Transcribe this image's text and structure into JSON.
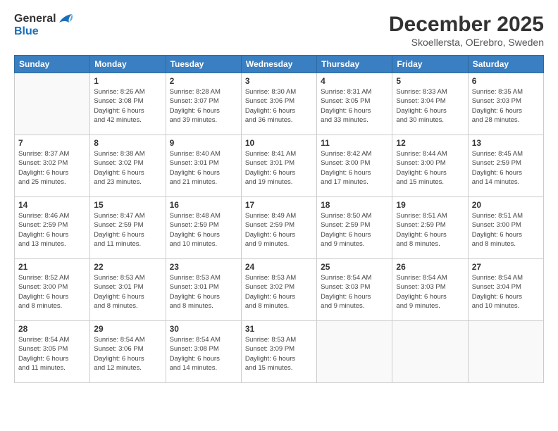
{
  "header": {
    "logo_general": "General",
    "logo_blue": "Blue",
    "main_title": "December 2025",
    "subtitle": "Skoellersta, OErebro, Sweden"
  },
  "calendar": {
    "days_of_week": [
      "Sunday",
      "Monday",
      "Tuesday",
      "Wednesday",
      "Thursday",
      "Friday",
      "Saturday"
    ],
    "weeks": [
      [
        {
          "day": "",
          "sunrise": "",
          "sunset": "",
          "daylight": ""
        },
        {
          "day": "1",
          "sunrise": "Sunrise: 8:26 AM",
          "sunset": "Sunset: 3:08 PM",
          "daylight": "Daylight: 6 hours and 42 minutes."
        },
        {
          "day": "2",
          "sunrise": "Sunrise: 8:28 AM",
          "sunset": "Sunset: 3:07 PM",
          "daylight": "Daylight: 6 hours and 39 minutes."
        },
        {
          "day": "3",
          "sunrise": "Sunrise: 8:30 AM",
          "sunset": "Sunset: 3:06 PM",
          "daylight": "Daylight: 6 hours and 36 minutes."
        },
        {
          "day": "4",
          "sunrise": "Sunrise: 8:31 AM",
          "sunset": "Sunset: 3:05 PM",
          "daylight": "Daylight: 6 hours and 33 minutes."
        },
        {
          "day": "5",
          "sunrise": "Sunrise: 8:33 AM",
          "sunset": "Sunset: 3:04 PM",
          "daylight": "Daylight: 6 hours and 30 minutes."
        },
        {
          "day": "6",
          "sunrise": "Sunrise: 8:35 AM",
          "sunset": "Sunset: 3:03 PM",
          "daylight": "Daylight: 6 hours and 28 minutes."
        }
      ],
      [
        {
          "day": "7",
          "sunrise": "Sunrise: 8:37 AM",
          "sunset": "Sunset: 3:02 PM",
          "daylight": "Daylight: 6 hours and 25 minutes."
        },
        {
          "day": "8",
          "sunrise": "Sunrise: 8:38 AM",
          "sunset": "Sunset: 3:02 PM",
          "daylight": "Daylight: 6 hours and 23 minutes."
        },
        {
          "day": "9",
          "sunrise": "Sunrise: 8:40 AM",
          "sunset": "Sunset: 3:01 PM",
          "daylight": "Daylight: 6 hours and 21 minutes."
        },
        {
          "day": "10",
          "sunrise": "Sunrise: 8:41 AM",
          "sunset": "Sunset: 3:01 PM",
          "daylight": "Daylight: 6 hours and 19 minutes."
        },
        {
          "day": "11",
          "sunrise": "Sunrise: 8:42 AM",
          "sunset": "Sunset: 3:00 PM",
          "daylight": "Daylight: 6 hours and 17 minutes."
        },
        {
          "day": "12",
          "sunrise": "Sunrise: 8:44 AM",
          "sunset": "Sunset: 3:00 PM",
          "daylight": "Daylight: 6 hours and 15 minutes."
        },
        {
          "day": "13",
          "sunrise": "Sunrise: 8:45 AM",
          "sunset": "Sunset: 2:59 PM",
          "daylight": "Daylight: 6 hours and 14 minutes."
        }
      ],
      [
        {
          "day": "14",
          "sunrise": "Sunrise: 8:46 AM",
          "sunset": "Sunset: 2:59 PM",
          "daylight": "Daylight: 6 hours and 13 minutes."
        },
        {
          "day": "15",
          "sunrise": "Sunrise: 8:47 AM",
          "sunset": "Sunset: 2:59 PM",
          "daylight": "Daylight: 6 hours and 11 minutes."
        },
        {
          "day": "16",
          "sunrise": "Sunrise: 8:48 AM",
          "sunset": "Sunset: 2:59 PM",
          "daylight": "Daylight: 6 hours and 10 minutes."
        },
        {
          "day": "17",
          "sunrise": "Sunrise: 8:49 AM",
          "sunset": "Sunset: 2:59 PM",
          "daylight": "Daylight: 6 hours and 9 minutes."
        },
        {
          "day": "18",
          "sunrise": "Sunrise: 8:50 AM",
          "sunset": "Sunset: 2:59 PM",
          "daylight": "Daylight: 6 hours and 9 minutes."
        },
        {
          "day": "19",
          "sunrise": "Sunrise: 8:51 AM",
          "sunset": "Sunset: 2:59 PM",
          "daylight": "Daylight: 6 hours and 8 minutes."
        },
        {
          "day": "20",
          "sunrise": "Sunrise: 8:51 AM",
          "sunset": "Sunset: 3:00 PM",
          "daylight": "Daylight: 6 hours and 8 minutes."
        }
      ],
      [
        {
          "day": "21",
          "sunrise": "Sunrise: 8:52 AM",
          "sunset": "Sunset: 3:00 PM",
          "daylight": "Daylight: 6 hours and 8 minutes."
        },
        {
          "day": "22",
          "sunrise": "Sunrise: 8:53 AM",
          "sunset": "Sunset: 3:01 PM",
          "daylight": "Daylight: 6 hours and 8 minutes."
        },
        {
          "day": "23",
          "sunrise": "Sunrise: 8:53 AM",
          "sunset": "Sunset: 3:01 PM",
          "daylight": "Daylight: 6 hours and 8 minutes."
        },
        {
          "day": "24",
          "sunrise": "Sunrise: 8:53 AM",
          "sunset": "Sunset: 3:02 PM",
          "daylight": "Daylight: 6 hours and 8 minutes."
        },
        {
          "day": "25",
          "sunrise": "Sunrise: 8:54 AM",
          "sunset": "Sunset: 3:03 PM",
          "daylight": "Daylight: 6 hours and 9 minutes."
        },
        {
          "day": "26",
          "sunrise": "Sunrise: 8:54 AM",
          "sunset": "Sunset: 3:03 PM",
          "daylight": "Daylight: 6 hours and 9 minutes."
        },
        {
          "day": "27",
          "sunrise": "Sunrise: 8:54 AM",
          "sunset": "Sunset: 3:04 PM",
          "daylight": "Daylight: 6 hours and 10 minutes."
        }
      ],
      [
        {
          "day": "28",
          "sunrise": "Sunrise: 8:54 AM",
          "sunset": "Sunset: 3:05 PM",
          "daylight": "Daylight: 6 hours and 11 minutes."
        },
        {
          "day": "29",
          "sunrise": "Sunrise: 8:54 AM",
          "sunset": "Sunset: 3:06 PM",
          "daylight": "Daylight: 6 hours and 12 minutes."
        },
        {
          "day": "30",
          "sunrise": "Sunrise: 8:54 AM",
          "sunset": "Sunset: 3:08 PM",
          "daylight": "Daylight: 6 hours and 14 minutes."
        },
        {
          "day": "31",
          "sunrise": "Sunrise: 8:53 AM",
          "sunset": "Sunset: 3:09 PM",
          "daylight": "Daylight: 6 hours and 15 minutes."
        },
        {
          "day": "",
          "sunrise": "",
          "sunset": "",
          "daylight": ""
        },
        {
          "day": "",
          "sunrise": "",
          "sunset": "",
          "daylight": ""
        },
        {
          "day": "",
          "sunrise": "",
          "sunset": "",
          "daylight": ""
        }
      ]
    ]
  }
}
